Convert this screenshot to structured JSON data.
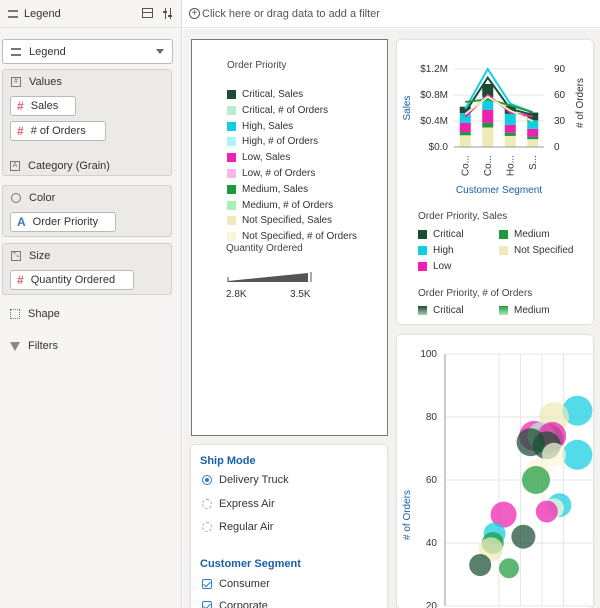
{
  "left_panel": {
    "header_title": "Legend",
    "legend_dropdown": "Legend",
    "values": {
      "label": "Values",
      "pills": [
        "Sales",
        "# of Orders"
      ]
    },
    "category_label": "Category (Grain)",
    "color": {
      "label": "Color",
      "pill": "Order Priority"
    },
    "size": {
      "label": "Size",
      "pill": "Quantity Ordered"
    },
    "shape_label": "Shape",
    "filters_label": "Filters"
  },
  "filter_bar": {
    "placeholder": "Click here or drag data to add a filter"
  },
  "legend_card": {
    "title": "Order Priority",
    "items": [
      {
        "label": "Critical, Sales",
        "color": "#1b4d33"
      },
      {
        "label": "Critical, # of Orders",
        "color": "#b8ecd3"
      },
      {
        "label": "High, Sales",
        "color": "#11cde0"
      },
      {
        "label": "High, # of Orders",
        "color": "#aef3f7"
      },
      {
        "label": "Low, Sales",
        "color": "#ef1fb0"
      },
      {
        "label": "Low, # of Orders",
        "color": "#f9b6e6"
      },
      {
        "label": "Medium, Sales",
        "color": "#1e9a3c"
      },
      {
        "label": "Medium, # of Orders",
        "color": "#aaf0b2"
      },
      {
        "label": "Not Specified, Sales",
        "color": "#efeab8"
      },
      {
        "label": "Not Specified, # of Orders",
        "color": "#f9f6d9"
      }
    ],
    "quantity_title": "Quantity Ordered",
    "quantity_min": "2.8K",
    "quantity_max": "3.5K"
  },
  "slicer": {
    "ship_mode_title": "Ship Mode",
    "ship_modes": [
      {
        "label": "Delivery Truck",
        "selected": true
      },
      {
        "label": "Express Air",
        "selected": false
      },
      {
        "label": "Regular Air",
        "selected": false
      }
    ],
    "segment_title": "Customer Segment",
    "segments": [
      {
        "label": "Consumer",
        "checked": true
      },
      {
        "label": "Corporate",
        "checked": true
      }
    ]
  },
  "combo_legend": {
    "sales_title": "Order Priority, Sales",
    "sales_items": [
      {
        "label": "Critical",
        "color": "#1b4d33"
      },
      {
        "label": "Medium",
        "color": "#1e9a3c"
      },
      {
        "label": "High",
        "color": "#11cde0"
      },
      {
        "label": "Not Specified",
        "color": "#efeab8"
      },
      {
        "label": "Low",
        "color": "#ef1fb0"
      }
    ],
    "orders_title": "Order Priority, # of Orders",
    "orders_items": [
      {
        "label": "Critical",
        "color": "#1b4d33"
      },
      {
        "label": "Medium",
        "color": "#1e9a3c"
      }
    ]
  },
  "chart_data": [
    {
      "type": "bar",
      "stacked": true,
      "combo_lines": true,
      "xlabel": "Customer Segment",
      "ylabel": "Sales",
      "y2label": "# of Orders",
      "categories": [
        "Co...",
        "Co...",
        "Ho...",
        "S..."
      ],
      "y_ticks": [
        "$0.0",
        "$0.4M",
        "$0.8M",
        "$1.2M"
      ],
      "y2_ticks": [
        "0",
        "30",
        "60",
        "90"
      ],
      "ylim": [
        0,
        1.2
      ],
      "y2lim": [
        0,
        90
      ],
      "series": [
        {
          "name": "Not Specified",
          "color": "#efeab8",
          "values": [
            0.18,
            0.3,
            0.17,
            0.12
          ]
        },
        {
          "name": "Medium",
          "color": "#1e9a3c",
          "values": [
            0.05,
            0.07,
            0.05,
            0.04
          ]
        },
        {
          "name": "Low",
          "color": "#ef1fb0",
          "values": [
            0.14,
            0.2,
            0.12,
            0.12
          ]
        },
        {
          "name": "High",
          "color": "#11cde0",
          "values": [
            0.15,
            0.2,
            0.17,
            0.13
          ]
        },
        {
          "name": "Critical",
          "color": "#1b4d33",
          "values": [
            0.1,
            0.2,
            0.12,
            0.12
          ]
        }
      ],
      "lines": [
        {
          "name": "Critical",
          "color": "#1b4d33",
          "values": [
            40,
            80,
            44,
            37
          ]
        },
        {
          "name": "High",
          "color": "#11cde0",
          "values": [
            44,
            90,
            50,
            40
          ]
        },
        {
          "name": "Low",
          "color": "#ef1fb0",
          "values": [
            35,
            60,
            40,
            35
          ]
        },
        {
          "name": "Medium",
          "color": "#1e9a3c",
          "values": [
            52,
            55,
            48,
            40
          ]
        },
        {
          "name": "Not Specified",
          "color": "#efeab8",
          "values": [
            38,
            58,
            42,
            30
          ]
        }
      ]
    },
    {
      "type": "scatter",
      "bubble": true,
      "ylabel": "# of Orders",
      "y_ticks": [
        "20",
        "40",
        "60",
        "80",
        "100"
      ],
      "ylim": [
        20,
        100
      ],
      "points": [
        {
          "x": 0.68,
          "y": 82,
          "r": 15,
          "color": "#11cde0"
        },
        {
          "x": 0.55,
          "y": 80,
          "r": 15,
          "color": "#efeab8"
        },
        {
          "x": 0.68,
          "y": 68,
          "r": 15,
          "color": "#11cde0"
        },
        {
          "x": 0.52,
          "y": 73,
          "r": 15,
          "color": "#1e9a3c"
        },
        {
          "x": 0.44,
          "y": 74,
          "r": 15,
          "color": "#ef1fb0"
        },
        {
          "x": 0.48,
          "y": 74,
          "r": 14,
          "color": "#b8ecd3"
        },
        {
          "x": 0.54,
          "y": 74,
          "r": 14,
          "color": "#ef1fb0"
        },
        {
          "x": 0.42,
          "y": 72,
          "r": 14,
          "color": "#1b4d33"
        },
        {
          "x": 0.51,
          "y": 71,
          "r": 14,
          "color": "#1b4d33"
        },
        {
          "x": 0.55,
          "y": 68,
          "r": 12,
          "color": "#f9f6d9"
        },
        {
          "x": 0.46,
          "y": 63,
          "r": 12,
          "color": "#f9f6d9"
        },
        {
          "x": 0.45,
          "y": 60,
          "r": 14,
          "color": "#1e9a3c"
        },
        {
          "x": 0.58,
          "y": 52,
          "r": 12,
          "color": "#11cde0"
        },
        {
          "x": 0.55,
          "y": 51,
          "r": 10,
          "color": "#f9f6d9"
        },
        {
          "x": 0.51,
          "y": 50,
          "r": 11,
          "color": "#ef1fb0"
        },
        {
          "x": 0.27,
          "y": 49,
          "r": 13,
          "color": "#ef1fb0"
        },
        {
          "x": 0.22,
          "y": 43,
          "r": 11,
          "color": "#11cde0"
        },
        {
          "x": 0.21,
          "y": 40,
          "r": 11,
          "color": "#1e9a3c"
        },
        {
          "x": 0.38,
          "y": 42,
          "r": 12,
          "color": "#1b4d33"
        },
        {
          "x": 0.2,
          "y": 38,
          "r": 12,
          "color": "#efeab8"
        },
        {
          "x": 0.14,
          "y": 33,
          "r": 11,
          "color": "#1b4d33"
        },
        {
          "x": 0.3,
          "y": 32,
          "r": 10,
          "color": "#1e9a3c"
        }
      ]
    }
  ]
}
